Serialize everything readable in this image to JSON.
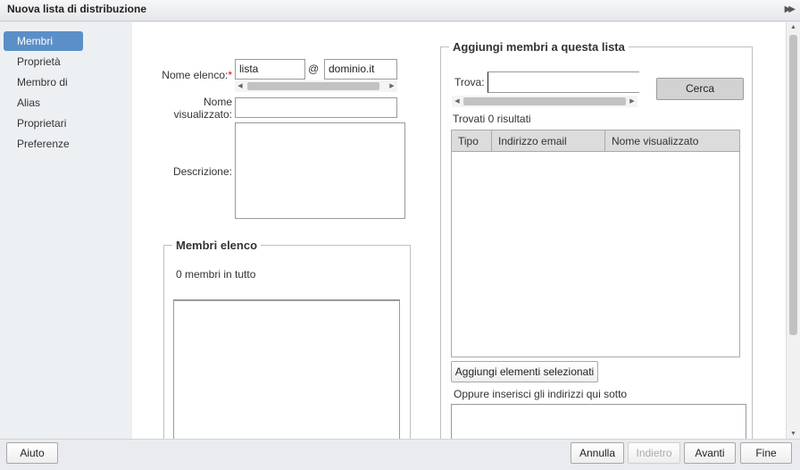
{
  "dialog": {
    "title": "Nuova lista di distribuzione"
  },
  "icons": {
    "expand": "double-chevron-right-icon",
    "scroll_left": "arrow-left-icon",
    "scroll_right": "arrow-right-icon",
    "scroll_up": "arrow-up-icon",
    "scroll_down": "arrow-down-icon"
  },
  "sidebar": {
    "items": [
      {
        "label": "Membri",
        "active": true
      },
      {
        "label": "Proprietà"
      },
      {
        "label": "Membro di"
      },
      {
        "label": "Alias"
      },
      {
        "label": "Proprietari"
      },
      {
        "label": "Preferenze"
      }
    ]
  },
  "form": {
    "list_name_label": "Nome elenco:",
    "required_mark": "*",
    "list_name_value": "lista",
    "at_sign": "@",
    "domain_value": "dominio.it",
    "display_name_label_1": "Nome",
    "display_name_label_2": "visualizzato:",
    "display_name_value": "",
    "description_label": "Descrizione:",
    "description_value": ""
  },
  "members": {
    "legend": "Membri elenco",
    "count_text": "0 membri in tutto"
  },
  "add_members": {
    "legend": "Aggiungi membri a questa lista",
    "find_label": "Trova:",
    "find_value": "",
    "search_button": "Cerca",
    "results_text": "Trovati 0 risultati",
    "columns": [
      "Tipo",
      "Indirizzo email",
      "Nome visualizzato"
    ],
    "add_selected_button": "Aggiungi elementi selezionati",
    "or_insert_text": "Oppure inserisci gli indirizzi qui sotto"
  },
  "footer": {
    "help": "Aiuto",
    "cancel": "Annulla",
    "back": "Indietro",
    "next": "Avanti",
    "finish": "Fine"
  },
  "colors": {
    "accent": "#5b8fc7",
    "required": "#dd0000"
  }
}
